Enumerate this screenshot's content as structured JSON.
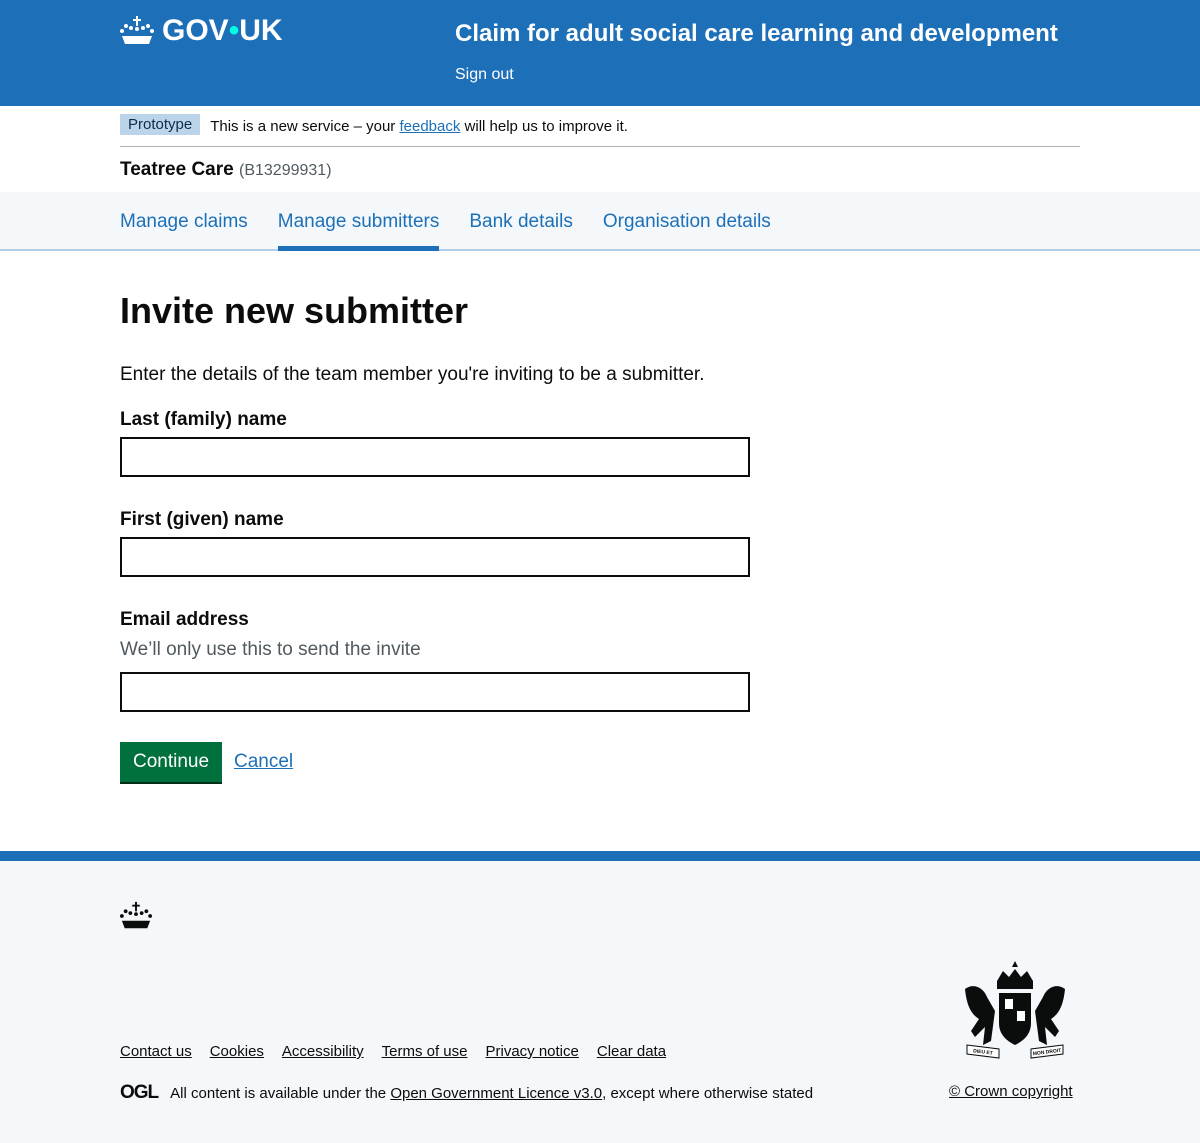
{
  "header": {
    "logo_text_1": "GOV",
    "logo_dot": "•",
    "logo_text_2": "UK",
    "service_name": "Claim for adult social care learning and development",
    "sign_out": "Sign out",
    "color": "#1d70b8"
  },
  "phase": {
    "tag": "Prototype",
    "text_before": "This is a new service – your ",
    "link": "feedback",
    "text_after": " will help us to improve it."
  },
  "organisation": {
    "name": "Teatree Care",
    "id": "(B13299931)"
  },
  "nav": {
    "items": [
      {
        "label": "Manage claims"
      },
      {
        "label": "Manage submitters",
        "active": true
      },
      {
        "label": "Bank details"
      },
      {
        "label": "Organisation details"
      }
    ]
  },
  "main": {
    "title": "Invite new submitter",
    "intro": "Enter the details of the team member you're inviting to be a submitter.",
    "fields": [
      {
        "label": "Last (family) name",
        "value": ""
      },
      {
        "label": "First (given) name",
        "value": ""
      },
      {
        "label": "Email address",
        "hint": "We’ll only use this to send the invite",
        "value": ""
      }
    ],
    "continue": "Continue",
    "cancel": "Cancel",
    "button_color": "#00703c"
  },
  "footer": {
    "links": [
      "Contact us",
      "Cookies",
      "Accessibility",
      "Terms of use",
      "Privacy notice",
      "Clear data"
    ],
    "ogl": "OGL",
    "licence_before": "All content is available under the ",
    "licence_link": "Open Government Licence v3.0",
    "licence_after": ", except where otherwise stated",
    "copyright": "© Crown copyright",
    "crest_motto_left": "DIEU ET",
    "crest_motto_right": "MON DROIT"
  }
}
